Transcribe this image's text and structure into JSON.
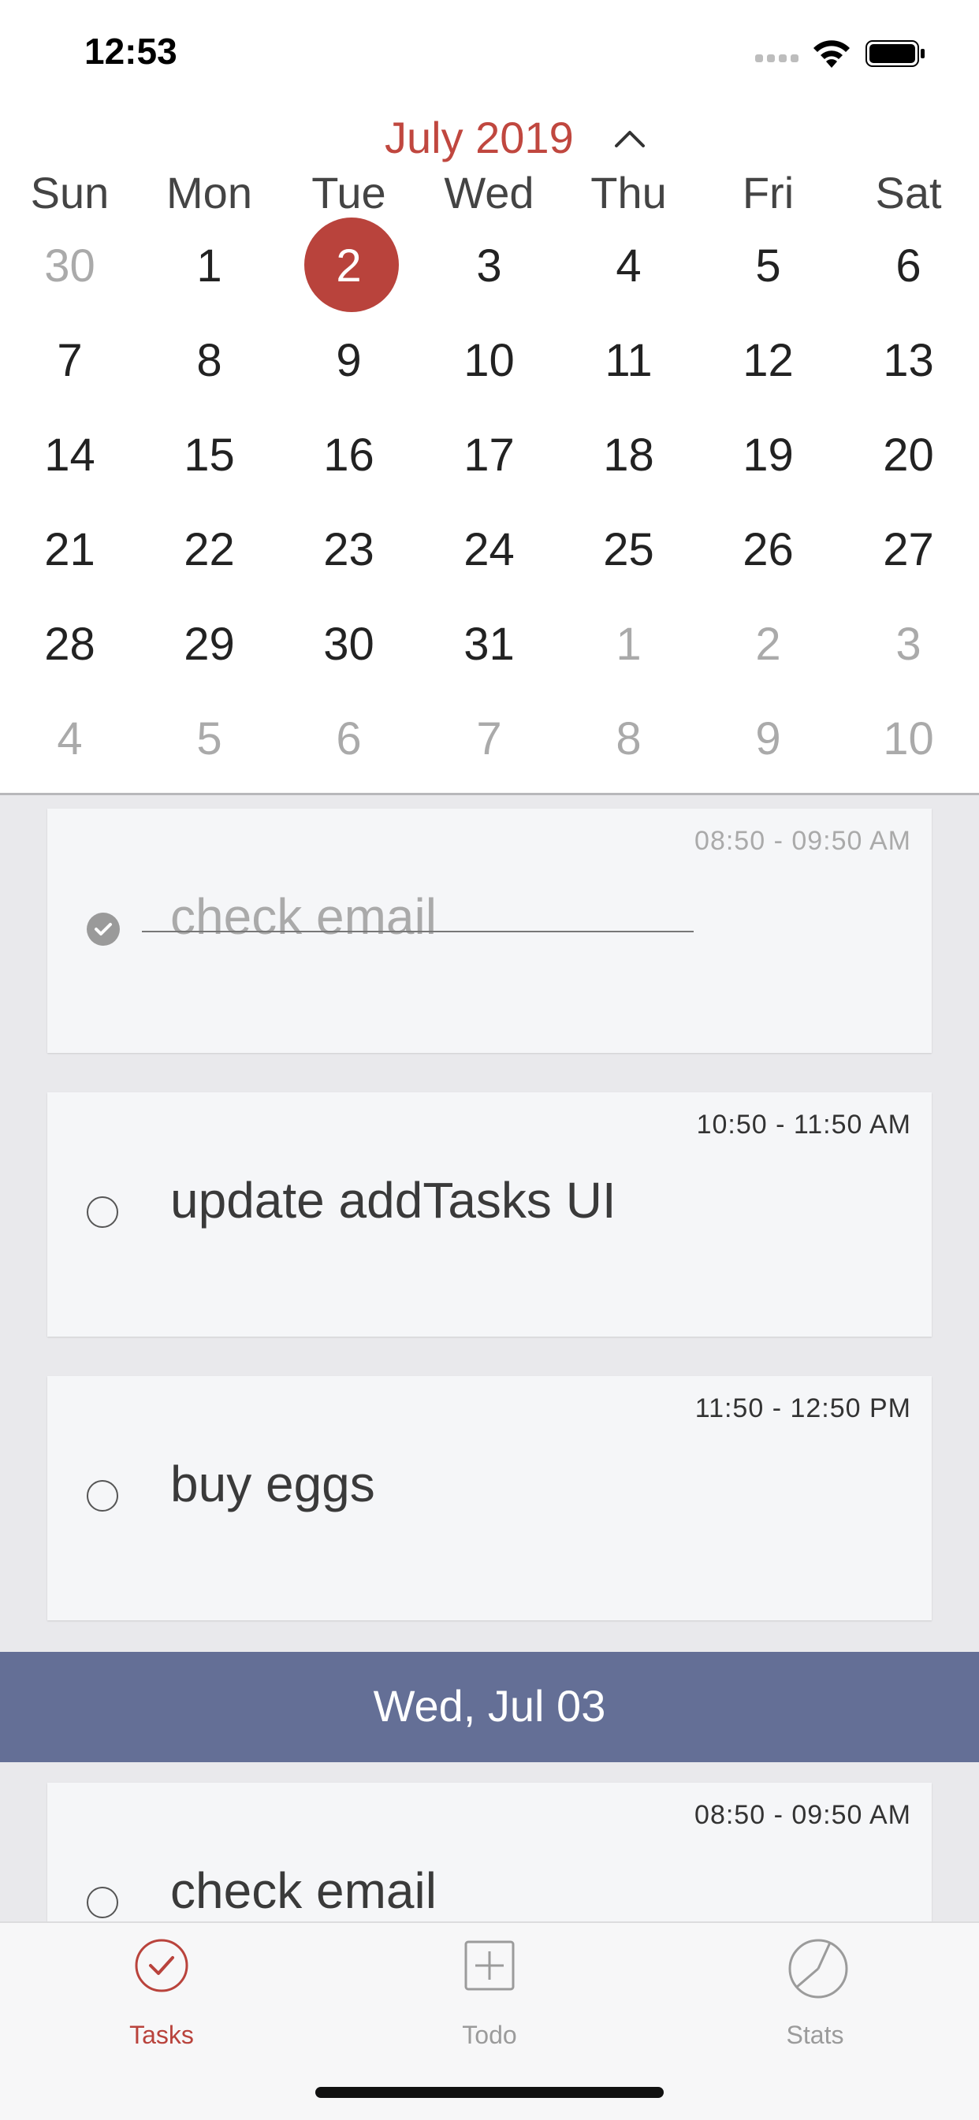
{
  "status_bar": {
    "time": "12:53"
  },
  "calendar": {
    "month_label": "July 2019",
    "weekdays": [
      "Sun",
      "Mon",
      "Tue",
      "Wed",
      "Thu",
      "Fri",
      "Sat"
    ],
    "weeks": [
      [
        {
          "d": "30",
          "m": true
        },
        {
          "d": "1"
        },
        {
          "d": "2",
          "sel": true
        },
        {
          "d": "3"
        },
        {
          "d": "4"
        },
        {
          "d": "5"
        },
        {
          "d": "6"
        }
      ],
      [
        {
          "d": "7"
        },
        {
          "d": "8"
        },
        {
          "d": "9"
        },
        {
          "d": "10"
        },
        {
          "d": "11"
        },
        {
          "d": "12"
        },
        {
          "d": "13"
        }
      ],
      [
        {
          "d": "14"
        },
        {
          "d": "15"
        },
        {
          "d": "16"
        },
        {
          "d": "17"
        },
        {
          "d": "18"
        },
        {
          "d": "19"
        },
        {
          "d": "20"
        }
      ],
      [
        {
          "d": "21"
        },
        {
          "d": "22"
        },
        {
          "d": "23"
        },
        {
          "d": "24"
        },
        {
          "d": "25"
        },
        {
          "d": "26"
        },
        {
          "d": "27"
        }
      ],
      [
        {
          "d": "28"
        },
        {
          "d": "29"
        },
        {
          "d": "30"
        },
        {
          "d": "31"
        },
        {
          "d": "1",
          "m": true
        },
        {
          "d": "2",
          "m": true
        },
        {
          "d": "3",
          "m": true
        }
      ],
      [
        {
          "d": "4",
          "m": true
        },
        {
          "d": "5",
          "m": true
        },
        {
          "d": "6",
          "m": true
        },
        {
          "d": "7",
          "m": true
        },
        {
          "d": "8",
          "m": true
        },
        {
          "d": "9",
          "m": true
        },
        {
          "d": "10",
          "m": true
        }
      ]
    ]
  },
  "tasks": [
    {
      "time": "08:50 - 09:50 AM",
      "title": "check email",
      "done": true
    },
    {
      "time": "10:50 - 11:50 AM",
      "title": "update addTasks UI",
      "done": false
    },
    {
      "time": "11:50 - 12:50 PM",
      "title": "buy eggs",
      "done": false
    }
  ],
  "section": {
    "label": "Wed, Jul 03"
  },
  "next_tasks": [
    {
      "time": "08:50 - 09:50 AM",
      "title": "check email",
      "done": false
    }
  ],
  "tabbar": {
    "tabs": [
      {
        "label": "Tasks",
        "icon": "check-circle-icon",
        "active": true
      },
      {
        "label": "Todo",
        "icon": "plus-square-icon",
        "active": false
      },
      {
        "label": "Stats",
        "icon": "pie-chart-icon",
        "active": false
      }
    ]
  },
  "colors": {
    "accent": "#b9433c",
    "section_bg": "#646f96"
  }
}
